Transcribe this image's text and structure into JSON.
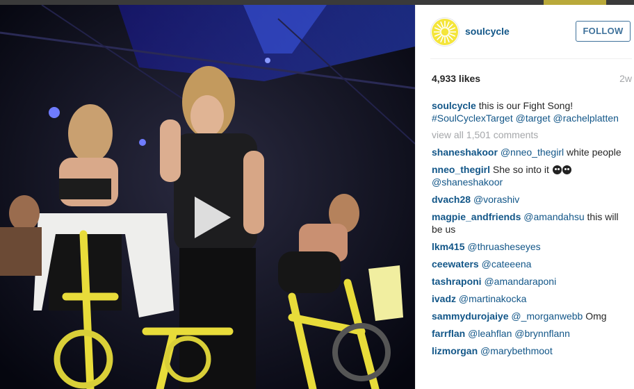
{
  "post": {
    "username": "soulcycle",
    "follow_label": "FOLLOW",
    "likes": "4,933 likes",
    "age": "2w",
    "caption": {
      "user": "soulcycle",
      "text": "this is our Fight Song!",
      "hashtag": "#SoulCyclexTarget",
      "mention1": "@target",
      "mention2": "@rachelplatten"
    },
    "view_all": "view all 1,501 comments"
  },
  "comments": [
    {
      "user": "shaneshakoor",
      "mention": "@nneo_thegirl",
      "text": "white people"
    },
    {
      "user": "nneo_thegirl",
      "text": "She so into it",
      "mention": "@shaneshakoor"
    },
    {
      "user": "dvach28",
      "mention": "@vorashiv",
      "text": ""
    },
    {
      "user": "magpie_andfriends",
      "mention": "@amandahsu",
      "text": "this will be us"
    },
    {
      "user": "lkm415",
      "mention": "@thruasheseyes",
      "text": ""
    },
    {
      "user": "ceewaters",
      "mention": "@cateeena",
      "text": ""
    },
    {
      "user": "tashraponi",
      "mention": "@amandaraponi",
      "text": ""
    },
    {
      "user": "ivadz",
      "mention": "@martinakocka",
      "text": ""
    },
    {
      "user": "sammydurojaiye",
      "mention": "@_morganwebb",
      "text": "Omg"
    },
    {
      "user": "farrflan",
      "mention": "@leahflan @brynnflann",
      "text": ""
    },
    {
      "user": "lizmorgan",
      "mention": "@marybethmoot",
      "text": ""
    }
  ],
  "colors": {
    "link": "#125688",
    "follow": "#3f729b",
    "muted": "#a5a7aa",
    "logo": "#f4e53b"
  },
  "icons": {
    "play": "play-icon",
    "logo": "soulcycle-wheel-logo"
  }
}
